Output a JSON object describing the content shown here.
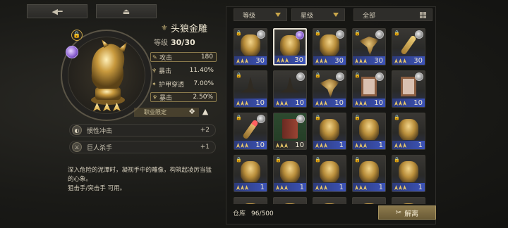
{
  "nav": {
    "back_icon": "back-arrow-icon",
    "eject_icon": "eject-icon"
  },
  "item": {
    "name": "头狼金雕",
    "level_label": "等级",
    "level_value": "30/30",
    "stars": 3,
    "stats": [
      {
        "label": "攻击",
        "value": "180",
        "boxed": true
      },
      {
        "label": "暴击",
        "value": "11.40%",
        "boxed": false
      },
      {
        "label": "护甲穿透",
        "value": "7.00%",
        "boxed": false
      },
      {
        "label": "暴击",
        "value": "2.50%",
        "boxed": true
      }
    ],
    "job_limit_label": "职业限定",
    "skills": [
      {
        "name": "惯性冲击",
        "value": "+2"
      },
      {
        "name": "巨人杀手",
        "value": "+1"
      }
    ],
    "description_lines": [
      "深入危险的泥潭时，凝视手中的雕像，构筑起凌厉当猛",
      "的心象。",
      "狙击手/突击手 可用。"
    ]
  },
  "filters": {
    "level": "等级",
    "star": "星级",
    "all": "全部"
  },
  "inventory": {
    "label": "仓库",
    "count": "96/500",
    "dismantle_label": "解离",
    "items": [
      {
        "art": "statue",
        "level": "30",
        "stars": 3,
        "lock": true,
        "badge": "grey",
        "blue": true
      },
      {
        "art": "statue",
        "level": "30",
        "stars": 3,
        "lock": false,
        "badge": "purple",
        "blue": true,
        "selected": true
      },
      {
        "art": "statue",
        "level": "30",
        "stars": 3,
        "lock": true,
        "badge": "grey",
        "blue": true
      },
      {
        "art": "bird",
        "level": "30",
        "stars": 3,
        "lock": true,
        "badge": "grey",
        "blue": true
      },
      {
        "art": "key",
        "level": "30",
        "stars": 3,
        "lock": true,
        "badge": "grey",
        "blue": true
      },
      {
        "art": "hat",
        "level": "10",
        "stars": 3,
        "lock": true,
        "badge": "",
        "blue": true
      },
      {
        "art": "hat",
        "level": "10",
        "stars": 3,
        "lock": false,
        "badge": "grey",
        "blue": true
      },
      {
        "art": "bird",
        "level": "10",
        "stars": 3,
        "lock": true,
        "badge": "grey",
        "blue": true
      },
      {
        "art": "frame",
        "level": "10",
        "stars": 3,
        "lock": true,
        "badge": "grey",
        "blue": true
      },
      {
        "art": "frame",
        "level": "10",
        "stars": 3,
        "lock": false,
        "badge": "grey",
        "blue": true
      },
      {
        "art": "key red",
        "level": "10",
        "stars": 3,
        "lock": true,
        "badge": "grey",
        "blue": true
      },
      {
        "art": "book",
        "level": "10",
        "stars": 3,
        "lock": false,
        "badge": "grey",
        "green": true
      },
      {
        "art": "statue",
        "level": "1",
        "stars": 3,
        "lock": true,
        "badge": "",
        "blue": true
      },
      {
        "art": "statue",
        "level": "1",
        "stars": 3,
        "lock": true,
        "badge": "",
        "blue": true
      },
      {
        "art": "statue",
        "level": "1",
        "stars": 3,
        "lock": true,
        "badge": "",
        "blue": true
      },
      {
        "art": "statue",
        "level": "1",
        "stars": 3,
        "lock": true,
        "badge": "",
        "blue": true
      },
      {
        "art": "statue",
        "level": "1",
        "stars": 3,
        "lock": true,
        "badge": "",
        "blue": true
      },
      {
        "art": "statue",
        "level": "1",
        "stars": 3,
        "lock": true,
        "badge": "",
        "blue": true
      },
      {
        "art": "statue",
        "level": "1",
        "stars": 3,
        "lock": true,
        "badge": "",
        "blue": true
      },
      {
        "art": "statue",
        "level": "1",
        "stars": 3,
        "lock": true,
        "badge": "",
        "blue": true
      },
      {
        "art": "statue",
        "level": "",
        "stars": 0,
        "lock": false,
        "badge": "",
        "blue": false
      },
      {
        "art": "statue",
        "level": "",
        "stars": 0,
        "lock": false,
        "badge": "",
        "blue": false
      },
      {
        "art": "statue",
        "level": "",
        "stars": 0,
        "lock": false,
        "badge": "",
        "blue": false
      },
      {
        "art": "statue",
        "level": "",
        "stars": 0,
        "lock": false,
        "badge": "",
        "blue": false
      },
      {
        "art": "statue",
        "level": "",
        "stars": 0,
        "lock": false,
        "badge": "",
        "blue": false
      }
    ]
  },
  "colors": {
    "accent_gold": "#c9a64a",
    "rarity_blue": "#3c53b8"
  }
}
